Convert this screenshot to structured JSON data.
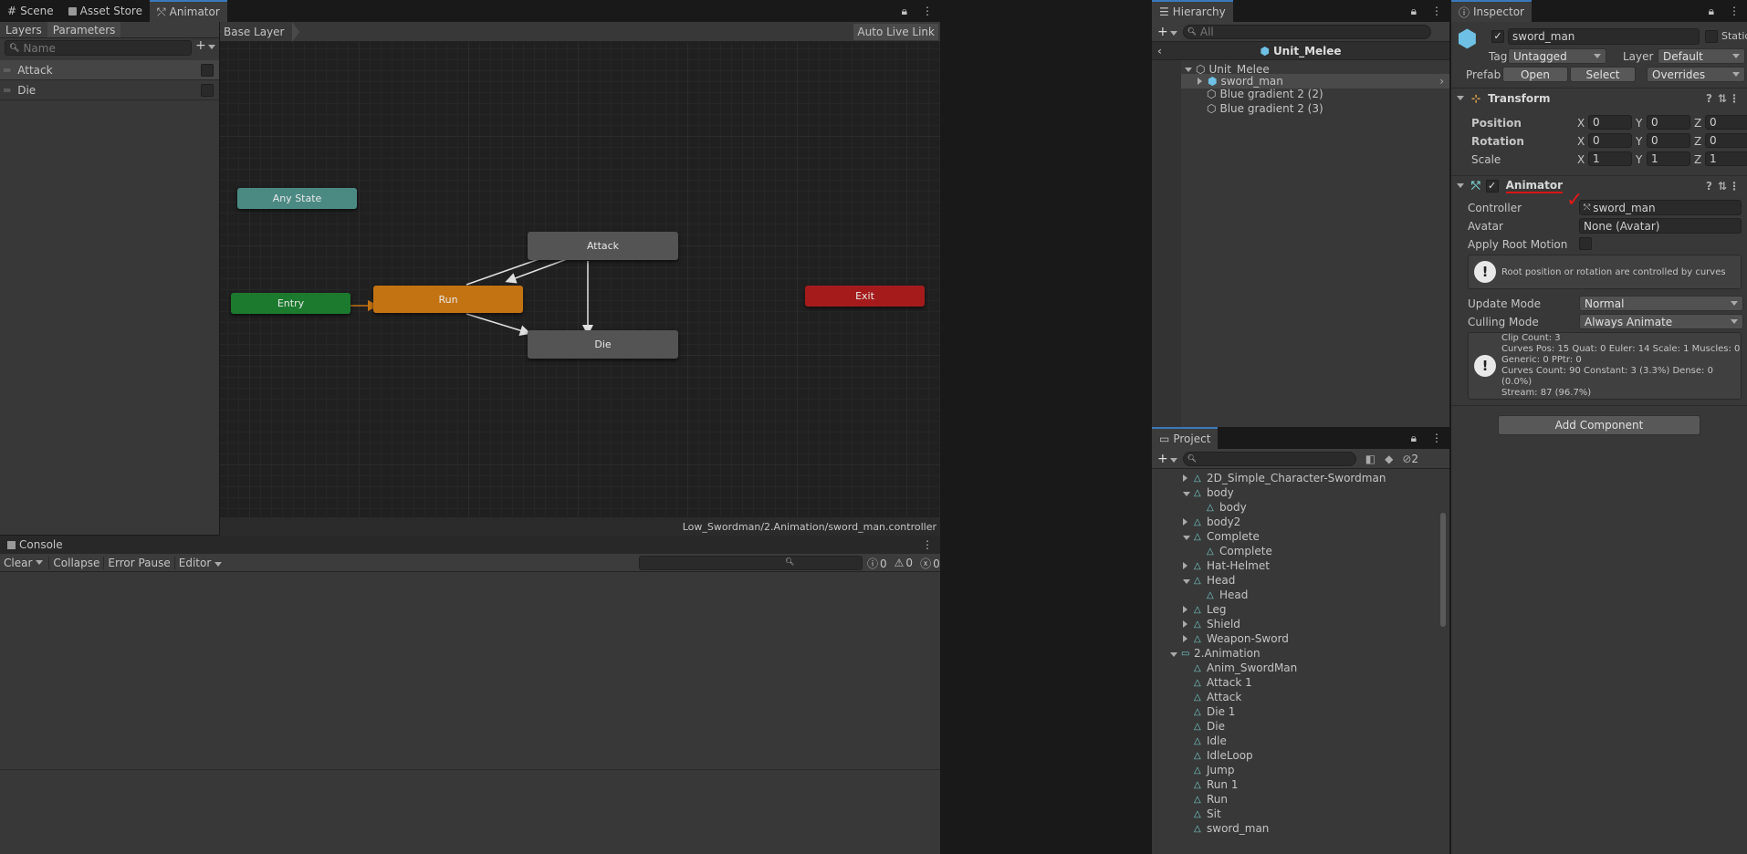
{
  "top_tabs": [
    {
      "label": "Scene",
      "icon": "grid-icon"
    },
    {
      "label": "Asset Store",
      "icon": "bag-icon"
    },
    {
      "label": "Animator",
      "icon": "animator-icon"
    }
  ],
  "animator": {
    "left_tabs": [
      "Layers",
      "Parameters"
    ],
    "search_placeholder": "Name",
    "params": [
      {
        "name": "Attack"
      },
      {
        "name": "Die"
      }
    ],
    "breadcrumb": "Base Layer",
    "live_link": "Auto Live Link",
    "states": {
      "any": "Any State",
      "entry": "Entry",
      "run": "Run",
      "attack": "Attack",
      "die": "Die",
      "exit": "Exit"
    },
    "footer_path": "Low_Swordman/2.Animation/sword_man.controller",
    "colors": {
      "any": "#4a8a83",
      "entry": "#1c7a2e",
      "run": "#c47312",
      "grey": "#545454",
      "exit": "#a51b1b"
    }
  },
  "console": {
    "title": "Console",
    "clear": "Clear",
    "collapse": "Collapse",
    "error_pause": "Error Pause",
    "editor": "Editor",
    "counts": [
      "0",
      "0",
      "0"
    ]
  },
  "hierarchy": {
    "title": "Hierarchy",
    "search": "All",
    "scene_title": "Unit_Melee",
    "items": [
      "Unit_Melee",
      "sword_man",
      "Blue gradient 2 (2)",
      "Blue gradient 2 (3)"
    ]
  },
  "project": {
    "title": "Project",
    "hidden_count": "2",
    "items": [
      {
        "label": "2D_Simple_Character-Swordman",
        "depth": 1,
        "arrow": "right"
      },
      {
        "label": "body",
        "depth": 1,
        "arrow": "down"
      },
      {
        "label": "body",
        "depth": 2,
        "arrow": ""
      },
      {
        "label": "body2",
        "depth": 1,
        "arrow": "right"
      },
      {
        "label": "Complete",
        "depth": 1,
        "arrow": "down"
      },
      {
        "label": "Complete",
        "depth": 2,
        "arrow": ""
      },
      {
        "label": "Hat-Helmet",
        "depth": 1,
        "arrow": "right"
      },
      {
        "label": "Head",
        "depth": 1,
        "arrow": "down"
      },
      {
        "label": "Head",
        "depth": 2,
        "arrow": ""
      },
      {
        "label": "Leg",
        "depth": 1,
        "arrow": "right"
      },
      {
        "label": "Shield",
        "depth": 1,
        "arrow": "right"
      },
      {
        "label": "Weapon-Sword",
        "depth": 1,
        "arrow": "right"
      },
      {
        "label": "2.Animation",
        "depth": 0,
        "arrow": "down"
      },
      {
        "label": "Anim_SwordMan",
        "depth": 1,
        "arrow": ""
      },
      {
        "label": "Attack 1",
        "depth": 1,
        "arrow": ""
      },
      {
        "label": "Attack",
        "depth": 1,
        "arrow": ""
      },
      {
        "label": "Die 1",
        "depth": 1,
        "arrow": ""
      },
      {
        "label": "Die",
        "depth": 1,
        "arrow": ""
      },
      {
        "label": "Idle",
        "depth": 1,
        "arrow": ""
      },
      {
        "label": "IdleLoop",
        "depth": 1,
        "arrow": ""
      },
      {
        "label": "Jump",
        "depth": 1,
        "arrow": ""
      },
      {
        "label": "Run 1",
        "depth": 1,
        "arrow": ""
      },
      {
        "label": "Run",
        "depth": 1,
        "arrow": ""
      },
      {
        "label": "Sit",
        "depth": 1,
        "arrow": ""
      },
      {
        "label": "sword_man",
        "depth": 1,
        "arrow": ""
      }
    ]
  },
  "inspector": {
    "title": "Inspector",
    "name": "sword_man",
    "static": "Static",
    "tag_label": "Tag",
    "tag": "Untagged",
    "layer_label": "Layer",
    "layer": "Default",
    "prefab_label": "Prefab",
    "open": "Open",
    "select": "Select",
    "overrides": "Overrides",
    "transform": {
      "title": "Transform",
      "position": "Position",
      "rotation": "Rotation",
      "scale": "Scale",
      "pos": [
        "0",
        "0",
        "0"
      ],
      "rot": [
        "0",
        "0",
        "0"
      ],
      "scl": [
        "1",
        "1",
        "1"
      ],
      "axes": [
        "X",
        "Y",
        "Z"
      ]
    },
    "animator": {
      "title": "Animator",
      "controller_label": "Controller",
      "controller": "sword_man",
      "avatar_label": "Avatar",
      "avatar": "None (Avatar)",
      "root_motion": "Apply Root Motion",
      "root_info": "Root position or rotation are controlled by curves",
      "update_label": "Update Mode",
      "update": "Normal",
      "culling_label": "Culling Mode",
      "culling": "Always Animate",
      "stats": [
        "Clip Count: 3",
        "Curves Pos: 15 Quat: 0 Euler: 14 Scale: 1 Muscles: 0",
        "Generic: 0 PPtr: 0",
        "Curves Count: 90 Constant: 3 (3.3%) Dense: 0 (0.0%)",
        "Stream: 87 (96.7%)"
      ]
    },
    "add_component": "Add Component"
  }
}
